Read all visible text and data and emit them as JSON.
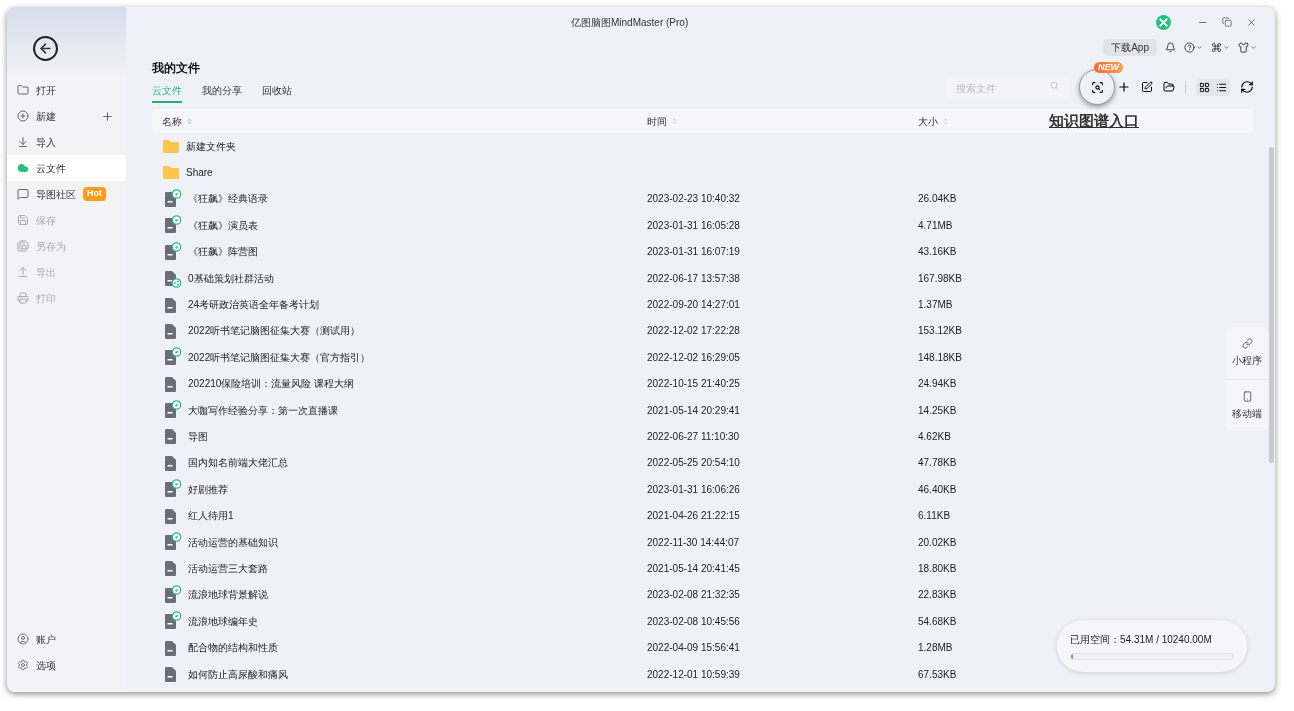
{
  "window": {
    "title": "亿图脑图MindMaster (Pro)"
  },
  "sidebar": {
    "items": [
      {
        "label": "打开",
        "selected": false,
        "disabled": false
      },
      {
        "label": "新建",
        "selected": false,
        "disabled": false,
        "add": true
      },
      {
        "label": "导入",
        "selected": false,
        "disabled": false
      },
      {
        "label": "云文件",
        "selected": true,
        "disabled": false
      },
      {
        "label": "导图社区",
        "selected": false,
        "disabled": false,
        "badge": "Hot"
      },
      {
        "label": "保存",
        "selected": false,
        "disabled": true
      },
      {
        "label": "另存为",
        "selected": false,
        "disabled": true
      },
      {
        "label": "导出",
        "selected": false,
        "disabled": true
      },
      {
        "label": "打印",
        "selected": false,
        "disabled": true
      }
    ],
    "bottom_items": [
      {
        "label": "账户"
      },
      {
        "label": "选项"
      }
    ]
  },
  "header": {
    "download_app": "下载App"
  },
  "page_title": "我的文件",
  "tabs": [
    {
      "label": "云文件",
      "selected": true
    },
    {
      "label": "我的分享",
      "selected": false
    },
    {
      "label": "回收站",
      "selected": false
    }
  ],
  "search": {
    "placeholder": "搜索文件"
  },
  "new_badge": "NEW",
  "callout": "知识图谱入口",
  "table": {
    "columns": [
      "名称",
      "时间",
      "大小"
    ],
    "rows": [
      {
        "kind": "folder",
        "name": "新建文件夹"
      },
      {
        "kind": "folder",
        "name": "Share"
      },
      {
        "kind": "published",
        "name": "《狂飙》经典语录",
        "time": "2023-02-23 10:40:32",
        "size": "26.04KB"
      },
      {
        "kind": "published",
        "name": "《狂飙》演员表",
        "time": "2023-01-31 16:05:28",
        "size": "4.71MB"
      },
      {
        "kind": "published",
        "name": "《狂飙》阵营图",
        "time": "2023-01-31 16:07:19",
        "size": "43.16KB"
      },
      {
        "kind": "shared",
        "name": "0基础策划社群活动",
        "time": "2022-06-17 13:57:38",
        "size": "167.98KB"
      },
      {
        "kind": "file",
        "name": "24考研政治英语全年备考计划",
        "time": "2022-09-20 14:27:01",
        "size": "1.37MB"
      },
      {
        "kind": "file",
        "name": "2022听书笔记脑图征集大赛（测试用）",
        "time": "2022-12-02 17:22:28",
        "size": "153.12KB"
      },
      {
        "kind": "published",
        "name": "2022听书笔记脑图征集大赛（官方指引）",
        "time": "2022-12-02 16:29:05",
        "size": "148.18KB"
      },
      {
        "kind": "file",
        "name": "202210保险培训：流量风险 课程大纲",
        "time": "2022-10-15 21:40:25",
        "size": "24.94KB"
      },
      {
        "kind": "published",
        "name": "大咖写作经验分享：第一次直播课",
        "time": "2021-05-14 20:29:41",
        "size": "14.25KB"
      },
      {
        "kind": "file",
        "name": "导图",
        "time": "2022-06-27 11:10:30",
        "size": "4.62KB"
      },
      {
        "kind": "file",
        "name": "国内知名前端大佬汇总",
        "time": "2022-05-25 20:54:10",
        "size": "47.78KB"
      },
      {
        "kind": "published",
        "name": "好剧推荐",
        "time": "2023-01-31 16:06:26",
        "size": "46.40KB"
      },
      {
        "kind": "file",
        "name": "红人待用1",
        "time": "2021-04-26 21:22:15",
        "size": "6.11KB"
      },
      {
        "kind": "published",
        "name": "活动运营的基础知识",
        "time": "2022-11-30 14:44:07",
        "size": "20.02KB"
      },
      {
        "kind": "file",
        "name": "活动运营三大套路",
        "time": "2021-05-14 20:41:45",
        "size": "18.80KB"
      },
      {
        "kind": "published",
        "name": "流浪地球背景解说",
        "time": "2023-02-08 21:32:35",
        "size": "22.83KB"
      },
      {
        "kind": "published",
        "name": "流浪地球编年史",
        "time": "2023-02-08 10:45:56",
        "size": "54.68KB"
      },
      {
        "kind": "file",
        "name": "配合物的结构和性质",
        "time": "2022-04-09 15:56:41",
        "size": "1.28MB"
      },
      {
        "kind": "file",
        "name": "如何防止高尿酸和痛风",
        "time": "2022-12-01 10:59:39",
        "size": "67.53KB"
      }
    ]
  },
  "side_panel": [
    {
      "label": "小程序"
    },
    {
      "label": "移动端"
    }
  ],
  "storage": {
    "label": "已用空间：54.31M / 10240.00M",
    "level": 0.015
  }
}
